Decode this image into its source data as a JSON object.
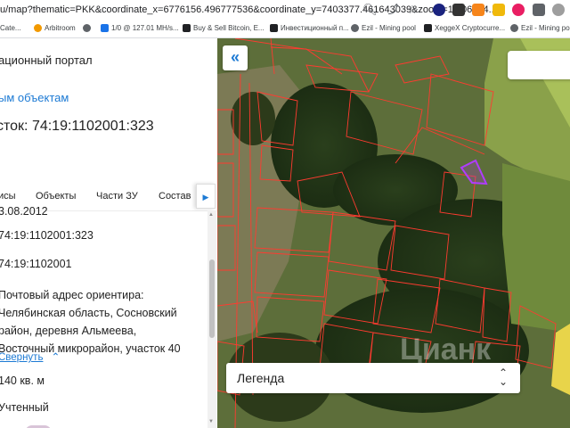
{
  "browser": {
    "url_path": "u/map?thematic=PKK&coordinate_x=6776156.496777536&coordinate_y=7403377.461643039&zoom=16.06674...",
    "bookmarks": [
      {
        "label": "Cate...",
        "color": "#e8710a"
      },
      {
        "label": "Arbitroom",
        "color": "#f29900"
      },
      {
        "label": "",
        "color": "#5f6368"
      },
      {
        "label": "1/0 @ 127.01 MH/s...",
        "color": "#1a73e8"
      },
      {
        "label": "Buy & Sell Bitcoin, E...",
        "color": "#202124"
      },
      {
        "label": "Инвестиционный п...",
        "color": "#202124"
      },
      {
        "label": "Ezil - Mining pool",
        "color": "#5f6368"
      },
      {
        "label": "XeggeX Cryptocurre...",
        "color": "#202124"
      },
      {
        "label": "Ezil - Mining pool",
        "color": "#5f6368"
      }
    ]
  },
  "panel": {
    "portal_title": "ационный портал",
    "back_link": "ым объектам",
    "parcel_title": "сток: 74:19:1102001:323",
    "tabs": [
      "исы",
      "Объекты",
      "Части ЗУ",
      "Состав"
    ],
    "rows": {
      "date": "3.08.2012",
      "cad_number": "74:19:1102001:323",
      "quarter": "74:19:1102001",
      "address_lines": [
        "Почтовый адрес ориентира:",
        "Челябинская область, Сосновский",
        "район, деревня Альмеева,",
        "Восточный микрорайон, участок 40"
      ],
      "collapse": "Свернуть",
      "area": " 140 кв. м",
      "status": "Учтенный"
    }
  },
  "map": {
    "legend_label": "Легенда",
    "watermark": "Цианк"
  }
}
